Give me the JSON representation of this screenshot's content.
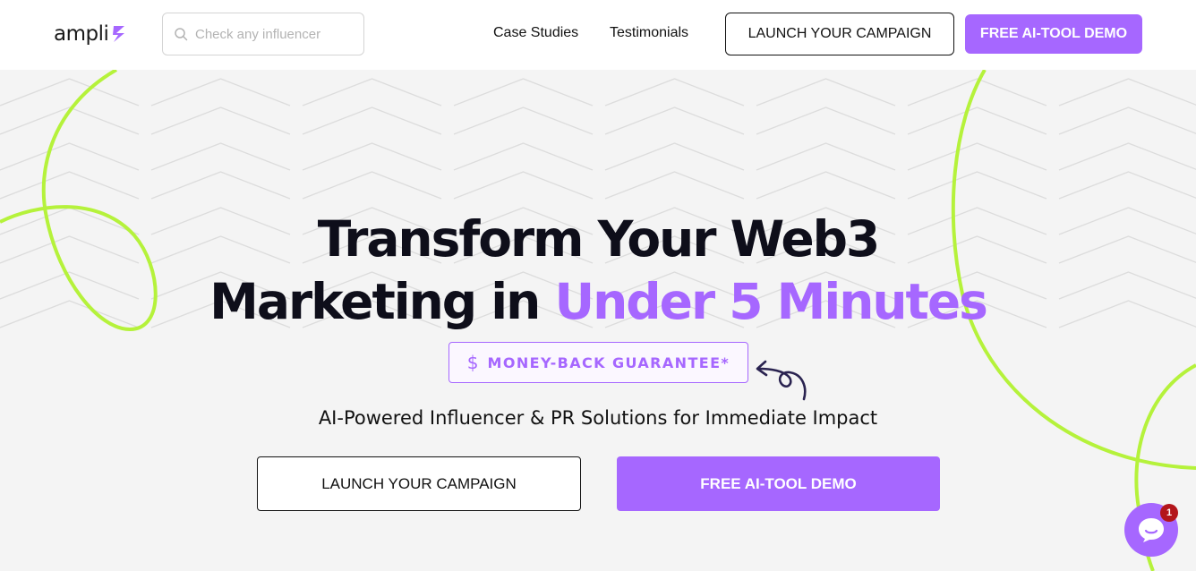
{
  "header": {
    "logo_text": "ampli",
    "search": {
      "placeholder": "Check any influencer",
      "value": ""
    },
    "nav": [
      {
        "label": "Case Studies"
      },
      {
        "label": "Testimonials"
      }
    ],
    "launch_label": "LAUNCH YOUR CAMPAIGN",
    "demo_label": "FREE AI-TOOL DEMO"
  },
  "hero": {
    "headline_line1": "Transform Your Web3",
    "headline_line2_prefix": "Marketing in ",
    "headline_line2_accent": "Under 5 Minutes",
    "guarantee_icon": "$",
    "guarantee_label": "MONEY-BACK GUARANTEE*",
    "subtitle": "AI-Powered Influencer & PR Solutions for Immediate Impact",
    "launch_label": "LAUNCH YOUR CAMPAIGN",
    "demo_label": "FREE AI-TOOL DEMO"
  },
  "chat": {
    "badge_count": "1"
  },
  "colors": {
    "accent": "#a667ff",
    "lime": "#b5f23b",
    "background": "#f4f4f4",
    "text": "#0e0e1a",
    "badge": "#b3151b"
  },
  "icons": {
    "logo": "bolt-icon",
    "search": "search-icon",
    "guarantee": "dollar-icon",
    "doodle": "curly-arrow-icon",
    "chat": "chat-bubble-icon"
  }
}
